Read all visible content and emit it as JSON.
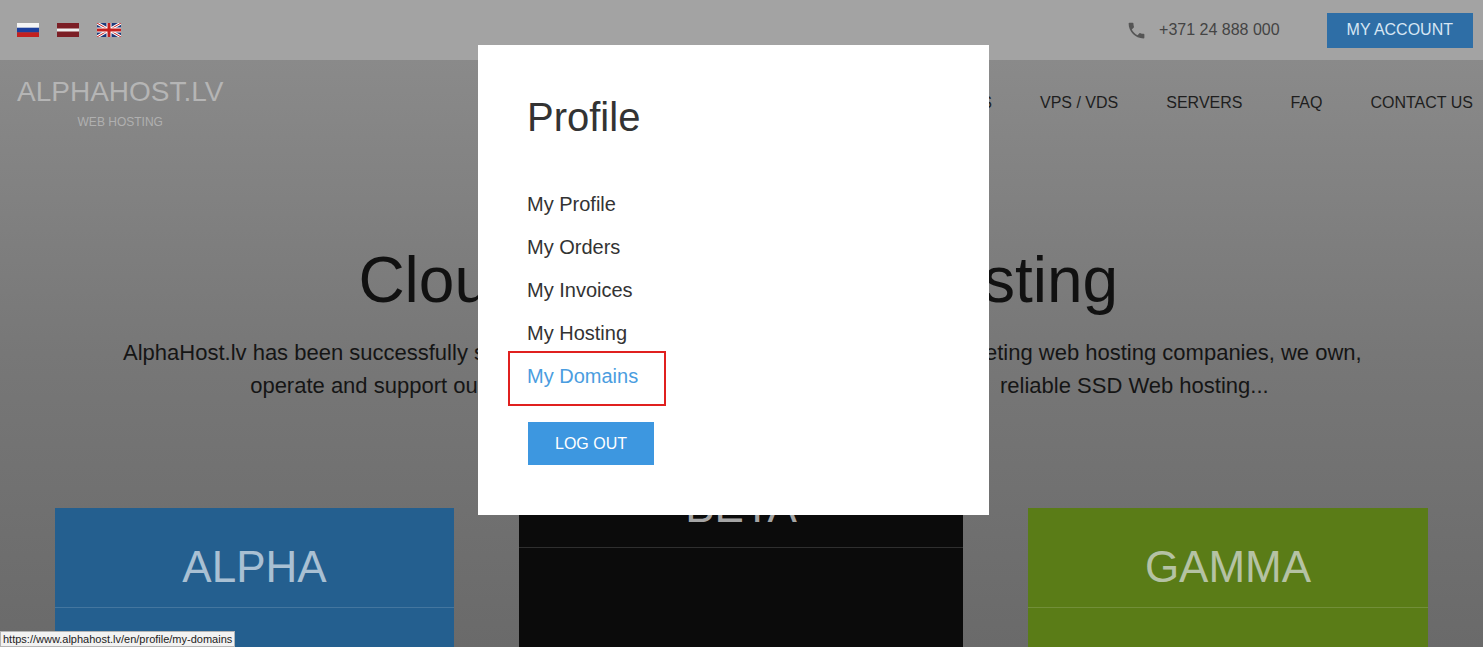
{
  "topbar": {
    "phone": "+371 24 888 000",
    "account_button": "MY ACCOUNT"
  },
  "logo": {
    "title": "ALPHAHOST.LV",
    "subtitle": "WEB HOSTING"
  },
  "nav": [
    "S",
    "VPS / VDS",
    "SERVERS",
    "FAQ",
    "CONTACT US"
  ],
  "hero": {
    "heading_left": "Clou",
    "heading_right": "sting",
    "lines": [
      {
        "left": "AlphaHost.lv has been successfully s",
        "right": "eting web hosting companies, we own,"
      },
      {
        "left": "operate and support our",
        "right": "reliable SSD Web hosting..."
      }
    ]
  },
  "plans": [
    {
      "name": "ALPHA",
      "color": "#245f8f"
    },
    {
      "name": "BETA",
      "color": "#0b0b0b"
    },
    {
      "name": "GAMMA",
      "color": "#5a7c17"
    }
  ],
  "modal": {
    "title": "Profile",
    "links": [
      {
        "label": "My Profile",
        "selected": false
      },
      {
        "label": "My Orders",
        "selected": false
      },
      {
        "label": "My Invoices",
        "selected": false
      },
      {
        "label": "My Hosting",
        "selected": false
      },
      {
        "label": "My Domains",
        "selected": true
      }
    ],
    "button": "LOG OUT"
  },
  "status_url": "https://www.alphahost.lv/en/profile/my-domains"
}
